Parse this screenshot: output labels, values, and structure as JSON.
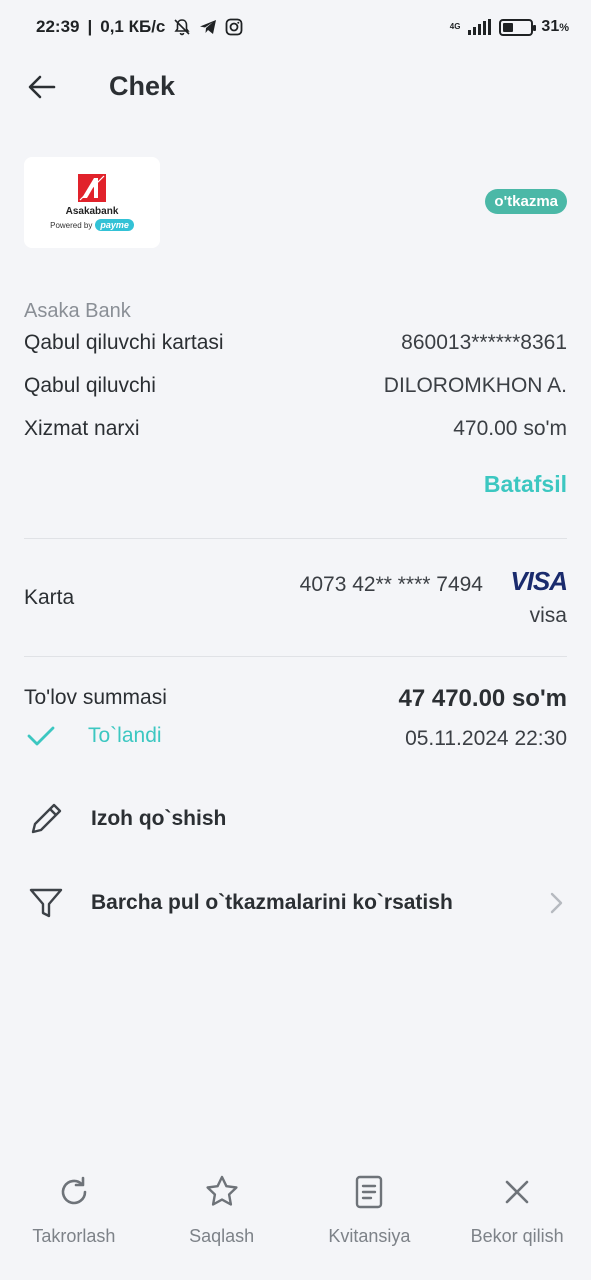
{
  "status_bar": {
    "time": "22:39",
    "speed": "0,1 КБ/с",
    "network": "4G",
    "battery_level": 0.31,
    "battery_pct": "31",
    "battery_unit": "%"
  },
  "header": {
    "title": "Chek"
  },
  "logo": {
    "bank_name": "Asakabank",
    "powered_by": "Powered by",
    "payme": "payme"
  },
  "badge": "o'tkazma",
  "details": {
    "provider": "Asaka Bank",
    "rows": [
      {
        "label": "Qabul qiluvchi kartasi",
        "value": "860013******8361"
      },
      {
        "label": "Qabul qiluvchi",
        "value": "DILOROMKHON A."
      },
      {
        "label": "Xizmat narxi",
        "value": "470.00 so'm"
      }
    ],
    "more_link": "Batafsil"
  },
  "card": {
    "label": "Karta",
    "number": "4073 42** **** 7494",
    "brand_logo": "VISA",
    "brand_text": "visa"
  },
  "payment": {
    "label": "To'lov summasi",
    "amount": "47 470.00 so'm",
    "status": "To`landi",
    "datetime": "05.11.2024 22:30"
  },
  "actions": [
    {
      "icon": "pencil-icon",
      "label": "Izoh qo`shish"
    },
    {
      "icon": "filter-icon",
      "label": "Barcha pul o`tkazmalarini ko`rsatish"
    }
  ],
  "bottom_nav": [
    {
      "icon": "refresh-icon",
      "label": "Takrorlash"
    },
    {
      "icon": "star-icon",
      "label": "Saqlash"
    },
    {
      "icon": "receipt-icon",
      "label": "Kvitansiya"
    },
    {
      "icon": "close-icon",
      "label": "Bekor qilish"
    }
  ],
  "colors": {
    "background": "#f4f5f8",
    "accent": "#3cc7c1",
    "badge": "#4bb8a7",
    "visa": "#1a2b6d",
    "asaka_red": "#e1222b"
  }
}
